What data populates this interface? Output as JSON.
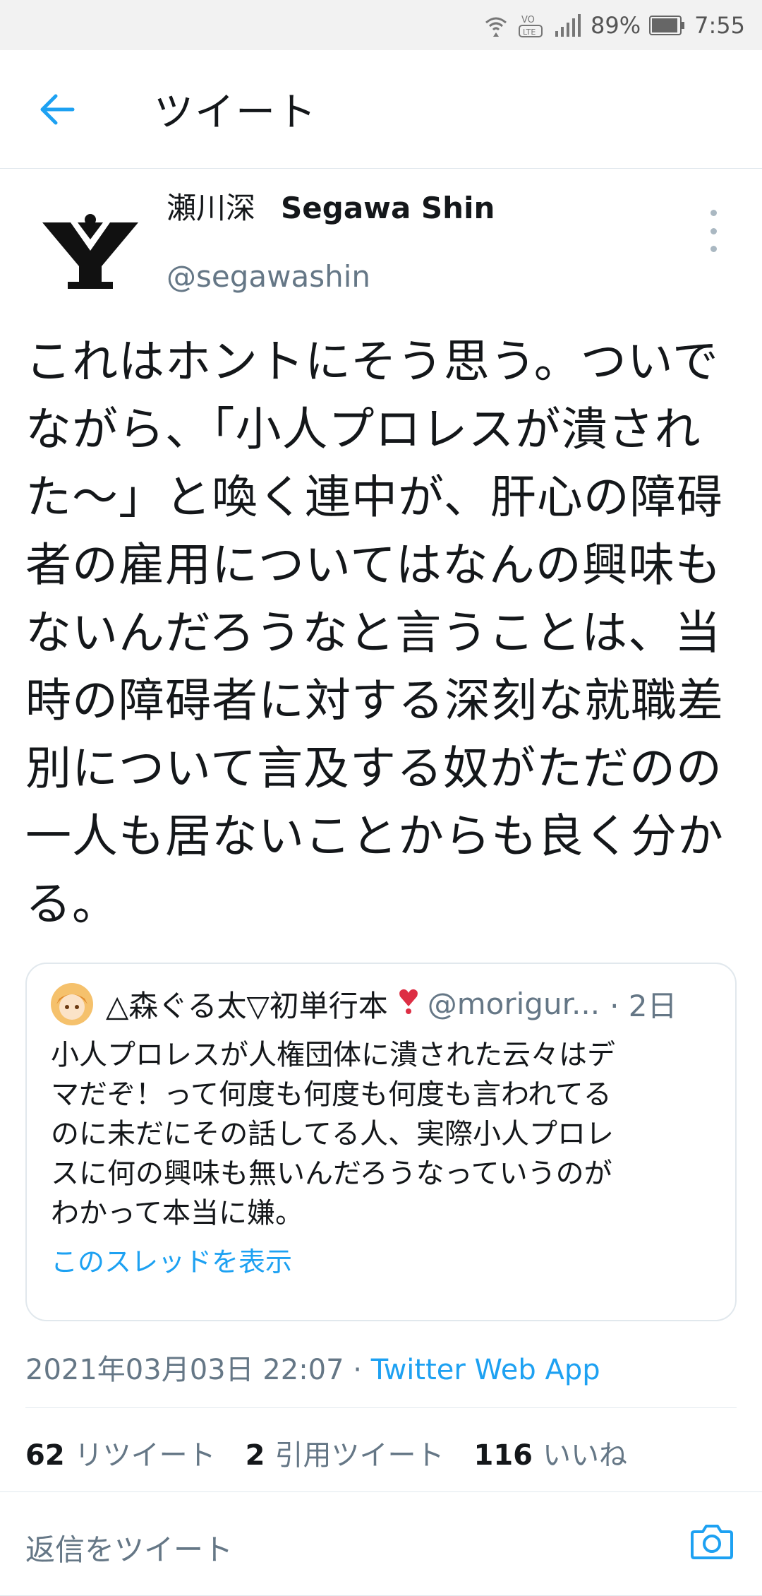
{
  "status_bar": {
    "battery": "89%",
    "time": "7:55"
  },
  "header": {
    "title": "ツイート"
  },
  "tweet": {
    "name_jp": "瀬川深",
    "name_en": "Segawa Shin",
    "handle": "@segawashin",
    "text": "これはホントにそう思う。ついで\nながら、「小人プロレスが潰され\nた〜」と喚く連中が、肝心の障碍\n者の雇用についてはなんの興味も\nないんだろうなと言うことは、当\n時の障碍者に対する深刻な就職差\n別について言及する奴がただのの\n一人も居ないことからも良く分か\nる。",
    "timestamp": "2021年03月03日 22:07",
    "separator": " · ",
    "source": "Twitter Web App"
  },
  "quote": {
    "name": "△森ぐる太▽初単行本",
    "handle": "@morigur...",
    "time": "· 2日",
    "text": "小人プロレスが人権団体に潰された云々はデ\nマだぞ！って何度も何度も何度も言われてる\nのに未だにその話してる人、実際小人プロレ\nスに何の興味も無いんだろうなっていうのが\nわかって本当に嫌。",
    "thread_link": "このスレッドを表示"
  },
  "stats": {
    "retweets_count": "62",
    "retweets_label": "リツイート",
    "quotes_count": "2",
    "quotes_label": "引用ツイート",
    "likes_count": "116",
    "likes_label": "いいね"
  },
  "reply": {
    "placeholder": "返信をツイート"
  },
  "colors": {
    "accent": "#1da1f2",
    "secondary_text": "#657786",
    "border": "#e1e8ed"
  }
}
